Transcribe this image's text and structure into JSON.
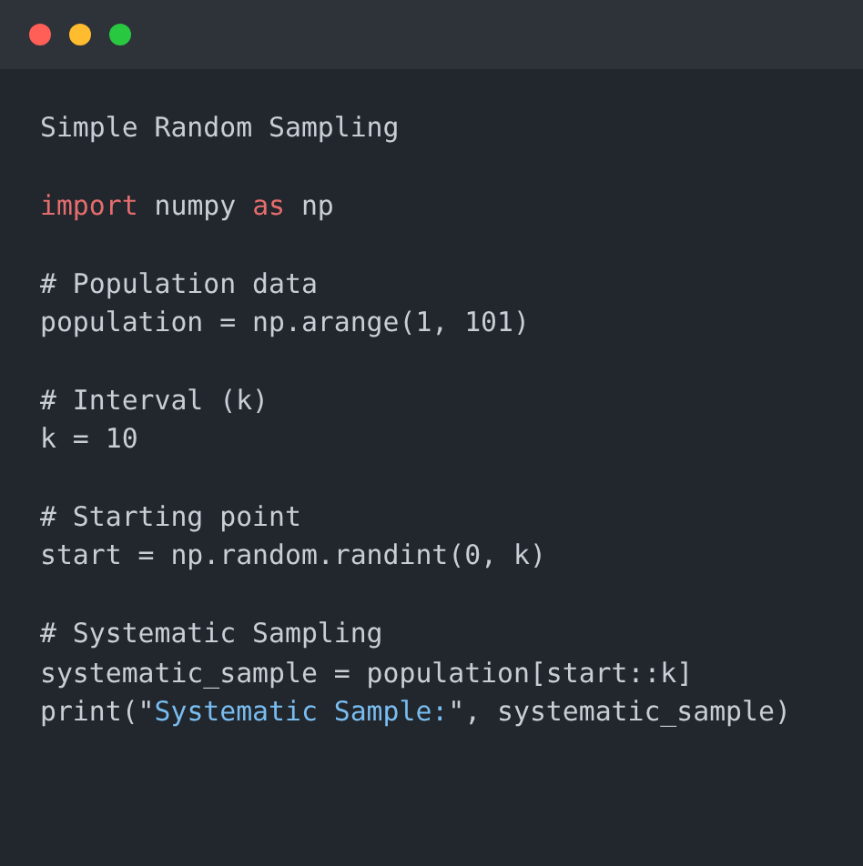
{
  "window": {
    "controls": [
      {
        "color": "#ff5f57"
      },
      {
        "color": "#febc2e"
      },
      {
        "color": "#28c840"
      }
    ]
  },
  "code_blocks": [
    [
      [
        {
          "text": "Simple Random Sampling",
          "kind": "plain"
        }
      ]
    ],
    [
      [
        {
          "text": "import",
          "kind": "keyword"
        },
        {
          "text": " numpy ",
          "kind": "plain"
        },
        {
          "text": "as",
          "kind": "keyword"
        },
        {
          "text": " np",
          "kind": "plain"
        }
      ]
    ],
    [
      [
        {
          "text": "# Population data",
          "kind": "plain"
        }
      ],
      [
        {
          "text": "population = np.arange(1, 101)",
          "kind": "plain"
        }
      ]
    ],
    [
      [
        {
          "text": "# Interval (k)",
          "kind": "plain"
        }
      ],
      [
        {
          "text": "k = 10",
          "kind": "plain"
        }
      ]
    ],
    [
      [
        {
          "text": "# Starting point",
          "kind": "plain"
        }
      ],
      [
        {
          "text": "start = np.random.randint(0, k)",
          "kind": "plain"
        }
      ]
    ],
    [
      [
        {
          "text": "# Systematic Sampling",
          "kind": "plain"
        }
      ],
      [
        {
          "text": "systematic_sample = population[start::k]",
          "kind": "plain"
        }
      ],
      [
        {
          "text": "print(\"",
          "kind": "plain"
        },
        {
          "text": "Systematic Sample:",
          "kind": "string"
        },
        {
          "text": "\", systematic_sample)",
          "kind": "plain"
        }
      ]
    ]
  ]
}
